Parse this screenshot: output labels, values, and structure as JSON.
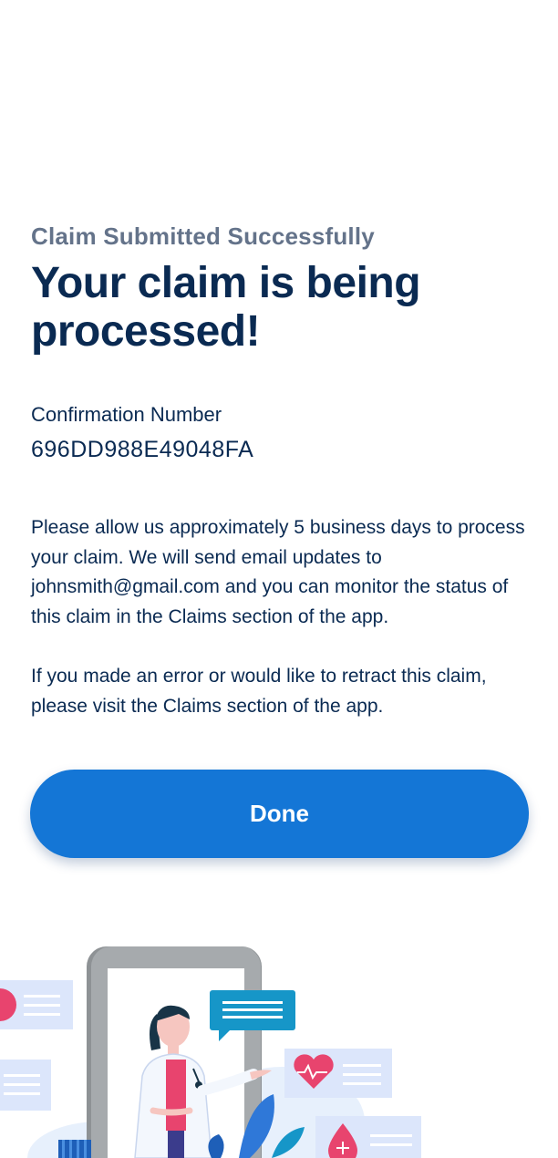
{
  "header": {
    "eyebrow": "Claim Submitted Successfully",
    "headline": "Your claim is being processed!"
  },
  "confirmation": {
    "label": "Confirmation Number",
    "number": "696DD988E49048FA"
  },
  "body": {
    "paragraph_1": "Please allow us approximately 5 business days to process your claim. We will send email updates to johnsmith@gmail.com and you can monitor the status of this claim in the Claims section of the app.",
    "paragraph_2": "If you made an error or would like to retract this claim, please visit the Claims section of the app."
  },
  "actions": {
    "done_label": "Done"
  },
  "illustration": {
    "name": "doctor-on-phone-illustration",
    "icons": [
      "caduceus-icon",
      "chat-bubble-icon",
      "heart-pulse-icon",
      "blood-drop-icon",
      "leaf-icon"
    ],
    "colors": {
      "phone_frame": "#8e9295",
      "card": "#dce6fb",
      "chat_bubble": "#1696c8",
      "heart": "#e8446e",
      "coat": "#ffffff",
      "hair": "#183447",
      "leaf": "#2f78d8"
    }
  },
  "theme": {
    "primary": "#1476d6",
    "heading": "#0a2a52",
    "eyebrow": "#64738a"
  }
}
